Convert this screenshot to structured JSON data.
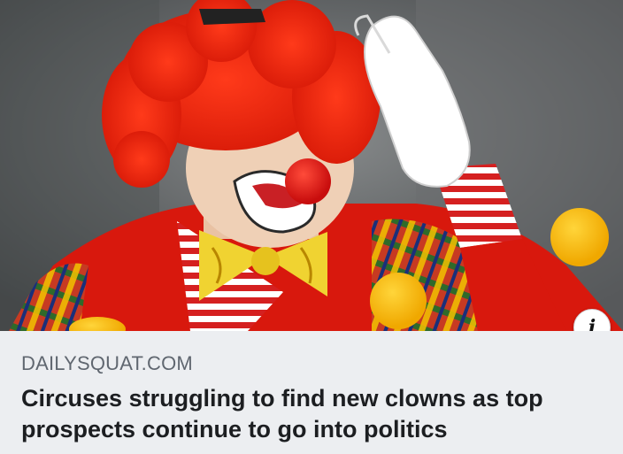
{
  "link_preview": {
    "image_alt_icon": "clown-photo",
    "info_icon_label": "i",
    "domain": "DAILYSQUAT.COM",
    "headline": "Circuses struggling to find new clowns as top prospects continue to go into politics"
  },
  "colors": {
    "meta_background": "#eceef1",
    "domain_text": "#606770",
    "headline_text": "#1c1e21"
  }
}
